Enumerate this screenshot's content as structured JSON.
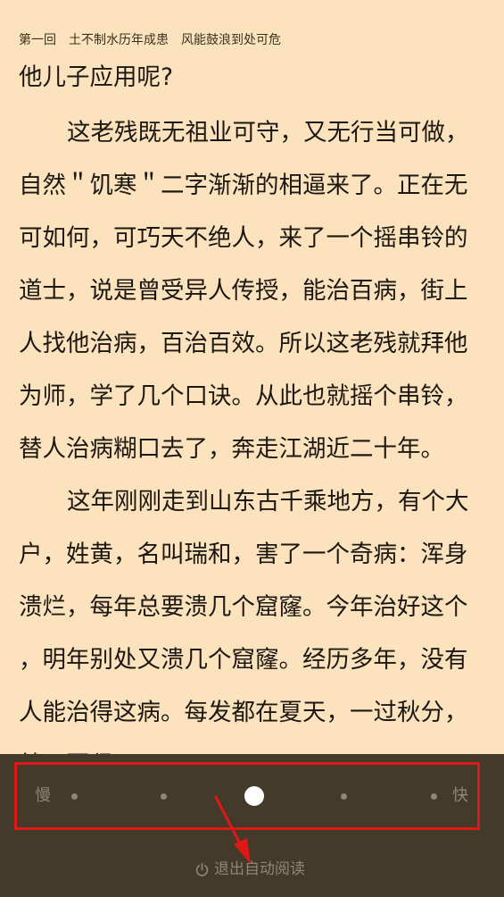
{
  "header": {
    "chapter": "第一回　土不制水历年成患　风能鼓浪到处可危"
  },
  "content": {
    "lines": [
      {
        "text": "他儿子应用呢?",
        "indent": false
      },
      {
        "text": "这老残既无祖业可守，又无行当可做，",
        "indent": true
      },
      {
        "text": "自然＂饥寒＂二字渐渐的相逼来了。正在无",
        "indent": false
      },
      {
        "text": "可如何，可巧天不绝人，来了一个摇串铃的",
        "indent": false
      },
      {
        "text": "道士，说是曾受异人传授，能治百病，街上",
        "indent": false
      },
      {
        "text": "人找他治病，百治百效。所以这老残就拜他",
        "indent": false
      },
      {
        "text": "为师，学了几个口诀。从此也就摇个串铃，",
        "indent": false
      },
      {
        "text": "替人治病糊口去了，奔走江湖近二十年。",
        "indent": false
      },
      {
        "text": "这年刚刚走到山东古千乘地方，有个大",
        "indent": true
      },
      {
        "text": "户，姓黄，名叫瑞和，害了一个奇病：浑身",
        "indent": false
      },
      {
        "text": "溃烂，每年总要溃几个窟窿。今年治好这个",
        "indent": false
      },
      {
        "text": "，明年别处又溃几个窟窿。经历多年，没有",
        "indent": false
      },
      {
        "text": "人能治得这病。每发都在夏天，一过秋分，",
        "indent": false
      },
      {
        "text": "就不要紧了。",
        "indent": false
      }
    ]
  },
  "auto_read": {
    "slow_label": "慢",
    "fast_label": "快",
    "speed_levels": 5,
    "current_level": 3,
    "exit_label": "退出自动阅读",
    "exit_icon": "power-icon"
  },
  "colors": {
    "page_bg": "#fde3bd",
    "panel_bg": "#433a2a",
    "highlight": "#e01717"
  }
}
